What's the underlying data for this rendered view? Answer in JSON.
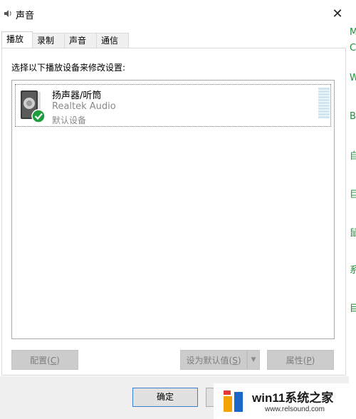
{
  "window": {
    "title": "声音",
    "close_glyph": "✕",
    "icon": "speaker-icon"
  },
  "tabs": [
    {
      "label": "播放",
      "active": true
    },
    {
      "label": "录制",
      "active": false
    },
    {
      "label": "声音",
      "active": false
    },
    {
      "label": "通信",
      "active": false
    }
  ],
  "instruction": "选择以下播放设备来修改设置:",
  "devices": [
    {
      "name": "扬声器/听筒",
      "driver": "Realtek Audio",
      "status": "默认设备",
      "icon": "speaker-icon",
      "badge": "check-icon",
      "level_meter": 0
    }
  ],
  "buttons": {
    "configure": {
      "label": "配置",
      "key": "C"
    },
    "set_default": {
      "label": "设为默认值",
      "key": "S"
    },
    "properties": {
      "label": "属性",
      "key": "P"
    },
    "ok": "确定"
  },
  "side_strip_glyphs": [
    "M",
    "C",
    "W",
    "B",
    "自",
    "巨",
    "鼠",
    "系",
    "目"
  ],
  "watermark": {
    "title": "win11系统之家",
    "url": "www.relsound.com"
  },
  "colors": {
    "badge_green": "#1e9e3e",
    "ok_border": "#3c7fd3",
    "disabled_button": "#cccccc"
  }
}
